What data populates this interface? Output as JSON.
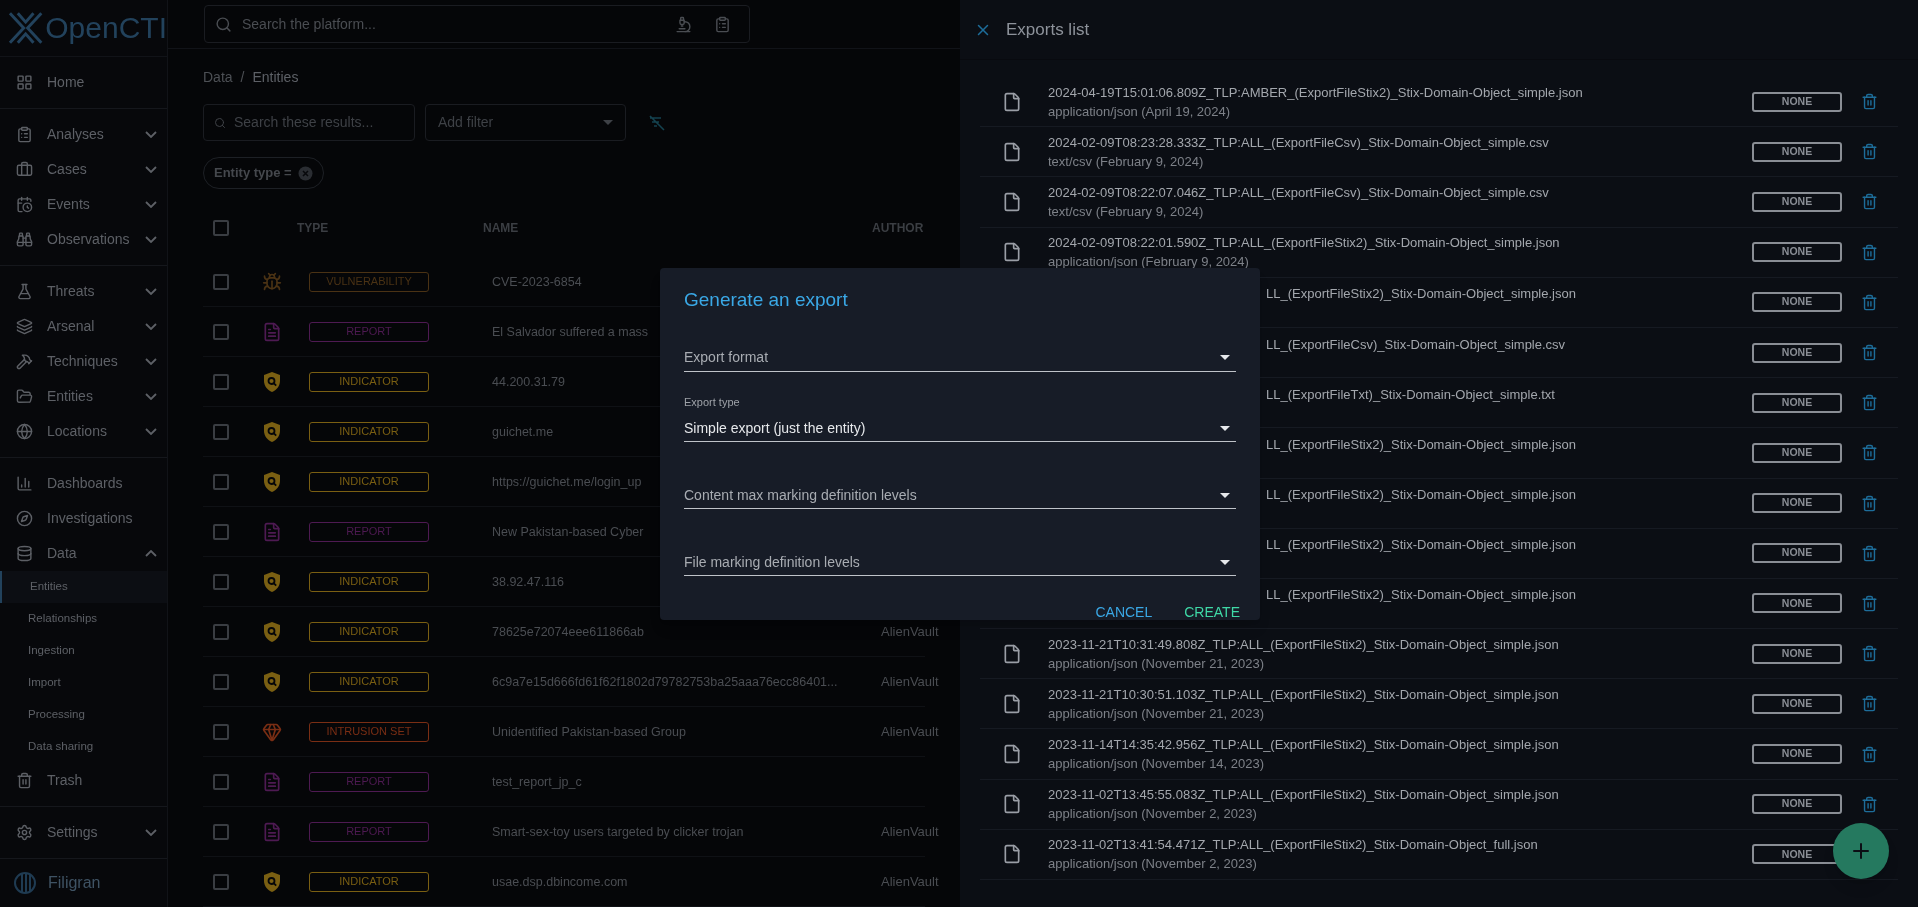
{
  "app": {
    "logo": "OpenCTI",
    "search": {
      "placeholder": "Search the platform..."
    }
  },
  "sidebar": {
    "groups": [
      [
        {
          "label": "Home"
        }
      ],
      [
        {
          "label": "Analyses",
          "expanded": false
        },
        {
          "label": "Cases",
          "expanded": false
        },
        {
          "label": "Events",
          "expanded": false
        },
        {
          "label": "Observations",
          "expanded": false
        }
      ],
      [
        {
          "label": "Threats",
          "expanded": false
        },
        {
          "label": "Arsenal",
          "expanded": false
        },
        {
          "label": "Techniques",
          "expanded": false
        },
        {
          "label": "Entities",
          "expanded": false
        },
        {
          "label": "Locations",
          "expanded": false
        }
      ],
      [
        {
          "label": "Dashboards"
        },
        {
          "label": "Investigations"
        },
        {
          "label": "Data",
          "expanded": true,
          "children": [
            {
              "label": "Entities",
              "selected": true
            },
            {
              "label": "Relationships",
              "selected": false
            },
            {
              "label": "Ingestion",
              "selected": false
            },
            {
              "label": "Import",
              "selected": false
            },
            {
              "label": "Processing",
              "selected": false
            },
            {
              "label": "Data sharing",
              "selected": false
            }
          ]
        },
        {
          "label": "Trash"
        }
      ],
      [
        {
          "label": "Settings",
          "expanded": false
        }
      ]
    ],
    "footer": "Filigran"
  },
  "breadcrumb": {
    "parent": "Data",
    "separator": "/",
    "current": "Entities"
  },
  "toolbar": {
    "search_placeholder": "Search these results...",
    "filter_placeholder": "Add filter",
    "chip": "Entity type ="
  },
  "table": {
    "header_checked": false,
    "columns": [
      "TYPE",
      "NAME",
      "AUTHOR"
    ],
    "rows": [
      {
        "kind": "vulnerability",
        "type": "VULNERABILITY",
        "color": "#4a3214",
        "name": "CVE-2023-6854",
        "checked": false
      },
      {
        "kind": "report",
        "type": "REPORT",
        "color": "#4e1a52",
        "name": "El Salvador suffered a mass",
        "checked": false
      },
      {
        "kind": "indicator",
        "type": "INDICATOR",
        "color": "#7a5f12",
        "name": "44.200.31.79",
        "checked": false
      },
      {
        "kind": "indicator",
        "type": "INDICATOR",
        "color": "#7a5f12",
        "name": "guichet.me",
        "checked": false
      },
      {
        "kind": "indicator",
        "type": "INDICATOR",
        "color": "#7a5f12",
        "name": "https://guichet.me/login_up",
        "checked": false
      },
      {
        "kind": "report",
        "type": "REPORT",
        "color": "#4e1a52",
        "name": "New Pakistan-based Cyber",
        "checked": false
      },
      {
        "kind": "indicator",
        "type": "INDICATOR",
        "color": "#7a5f12",
        "name": "38.92.47.116",
        "checked": false
      },
      {
        "kind": "indicator",
        "type": "INDICATOR",
        "color": "#7a5f12",
        "name": "78625e72074eee611866ab",
        "author": "AlienVault",
        "checked": false
      },
      {
        "kind": "indicator",
        "type": "INDICATOR",
        "color": "#7a5f12",
        "name": "6c9a7e15d666fd61f62f1802d79782753ba25aaa76ecc86401...",
        "author": "AlienVault",
        "checked": false
      },
      {
        "kind": "intrusion-set",
        "type": "INTRUSION SET",
        "color": "#7a2e14",
        "name": "Unidentified Pakistan-based Group",
        "author": "AlienVault",
        "checked": false
      },
      {
        "kind": "report",
        "type": "REPORT",
        "color": "#4e1a52",
        "name": "test_report_jp_c",
        "checked": false
      },
      {
        "kind": "report",
        "type": "REPORT",
        "color": "#4e1a52",
        "name": "Smart-sex-toy users targeted by clicker trojan",
        "author": "AlienVault",
        "checked": false
      },
      {
        "kind": "indicator",
        "type": "INDICATOR",
        "color": "#7a5f12",
        "name": "usae.dsp.dbincome.com",
        "author": "AlienVault",
        "checked": false
      }
    ]
  },
  "exports": {
    "title": "Exports list",
    "files": [
      {
        "kind": "full",
        "name": "2024-04-19T15:01:06.809Z_TLP:AMBER_(ExportFileStix2)_Stix-Domain-Object_simple.json",
        "subtitle": "application/json (April 19, 2024)",
        "marking": "NONE"
      },
      {
        "kind": "full",
        "name": "2024-02-09T08:23:28.333Z_TLP:ALL_(ExportFileCsv)_Stix-Domain-Object_simple.csv",
        "subtitle": "text/csv (February 9, 2024)",
        "marking": "NONE"
      },
      {
        "kind": "full",
        "name": "2024-02-09T08:22:07.046Z_TLP:ALL_(ExportFileCsv)_Stix-Domain-Object_simple.csv",
        "subtitle": "text/csv (February 9, 2024)",
        "marking": "NONE"
      },
      {
        "kind": "full",
        "name": "2024-02-09T08:22:01.590Z_TLP:ALL_(ExportFileStix2)_Stix-Domain-Object_simple.json",
        "subtitle": "application/json (February 9, 2024)",
        "marking": "NONE"
      },
      {
        "kind": "partial",
        "name": "LL_(ExportFileStix2)_Stix-Domain-Object_simple.json",
        "marking": "NONE"
      },
      {
        "kind": "partial",
        "name": "LL_(ExportFileCsv)_Stix-Domain-Object_simple.csv",
        "marking": "NONE"
      },
      {
        "kind": "partial",
        "name": "LL_(ExportFileTxt)_Stix-Domain-Object_simple.txt",
        "marking": "NONE"
      },
      {
        "kind": "partial",
        "name": "LL_(ExportFileStix2)_Stix-Domain-Object_simple.json",
        "marking": "NONE"
      },
      {
        "kind": "partial",
        "name": "LL_(ExportFileStix2)_Stix-Domain-Object_simple.json",
        "marking": "NONE"
      },
      {
        "kind": "partial",
        "name": "LL_(ExportFileStix2)_Stix-Domain-Object_simple.json",
        "marking": "NONE"
      },
      {
        "kind": "partial",
        "name": "LL_(ExportFileStix2)_Stix-Domain-Object_simple.json",
        "marking": "NONE"
      },
      {
        "kind": "full",
        "name": "2023-11-21T10:31:49.808Z_TLP:ALL_(ExportFileStix2)_Stix-Domain-Object_simple.json",
        "subtitle": "application/json (November 21, 2023)",
        "marking": "NONE"
      },
      {
        "kind": "full",
        "name": "2023-11-21T10:30:51.103Z_TLP:ALL_(ExportFileStix2)_Stix-Domain-Object_simple.json",
        "subtitle": "application/json (November 21, 2023)",
        "marking": "NONE"
      },
      {
        "kind": "full",
        "name": "2023-11-14T14:35:42.956Z_TLP:ALL_(ExportFileStix2)_Stix-Domain-Object_simple.json",
        "subtitle": "application/json (November 14, 2023)",
        "marking": "NONE"
      },
      {
        "kind": "full",
        "name": "2023-11-02T13:45:55.083Z_TLP:ALL_(ExportFileStix2)_Stix-Domain-Object_simple.json",
        "subtitle": "application/json (November 2, 2023)",
        "marking": "NONE"
      },
      {
        "kind": "full",
        "name": "2023-11-02T13:41:54.471Z_TLP:ALL_(ExportFileStix2)_Stix-Domain-Object_full.json",
        "subtitle": "application/json (November 2, 2023)",
        "marking": "NONE"
      }
    ]
  },
  "dialog": {
    "title": "Generate an export",
    "fields": [
      {
        "placeholder": "Export format"
      },
      {
        "label": "Export type",
        "value": "Simple export (just the entity)"
      },
      {
        "placeholder": "Content max marking definition levels"
      },
      {
        "placeholder": "File marking definition levels"
      }
    ],
    "buttons": [
      {
        "kind": "cancel",
        "label": "CANCEL"
      },
      {
        "kind": "create",
        "label": "CREATE"
      }
    ]
  }
}
